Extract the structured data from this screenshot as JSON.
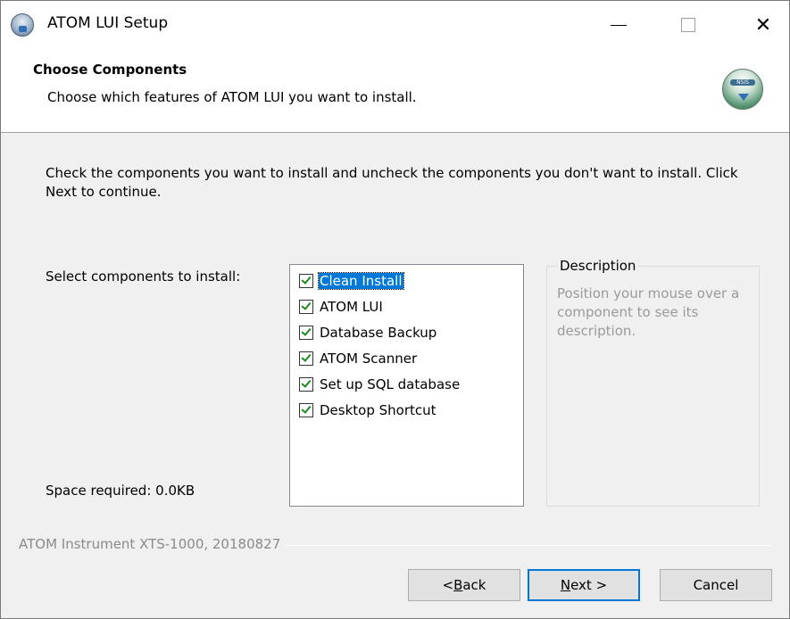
{
  "window": {
    "title": "ATOM LUI Setup",
    "controls": {
      "minimize": "minimize",
      "maximize": "maximize",
      "close": "✕"
    }
  },
  "header": {
    "title": "Choose Components",
    "subtitle": "Choose which features of ATOM LUI you want to install.",
    "logo_text": "NSIS"
  },
  "intro": "Check the components you want to install and uncheck the components you don't want to install. Click Next to continue.",
  "select_label": "Select components to install:",
  "space_required": "Space required: 0.0KB",
  "components": [
    {
      "label": "Clean Install",
      "checked": true,
      "selected": true
    },
    {
      "label": "ATOM LUI",
      "checked": true,
      "selected": false
    },
    {
      "label": "Database Backup",
      "checked": true,
      "selected": false
    },
    {
      "label": "ATOM Scanner",
      "checked": true,
      "selected": false
    },
    {
      "label": "Set up SQL database",
      "checked": true,
      "selected": false
    },
    {
      "label": "Desktop Shortcut",
      "checked": true,
      "selected": false
    }
  ],
  "description": {
    "title": "Description",
    "text": "Position your mouse over a component to see its description."
  },
  "footer": "ATOM Instrument XTS-1000, 20180827",
  "buttons": {
    "back": {
      "prefix": "< ",
      "accel": "B",
      "rest": "ack"
    },
    "next": {
      "accel": "N",
      "rest": "ext >"
    },
    "cancel": "Cancel"
  },
  "colors": {
    "selection": "#0078d7",
    "check": "#1b8a1b",
    "default_button_border": "#0078d7"
  }
}
